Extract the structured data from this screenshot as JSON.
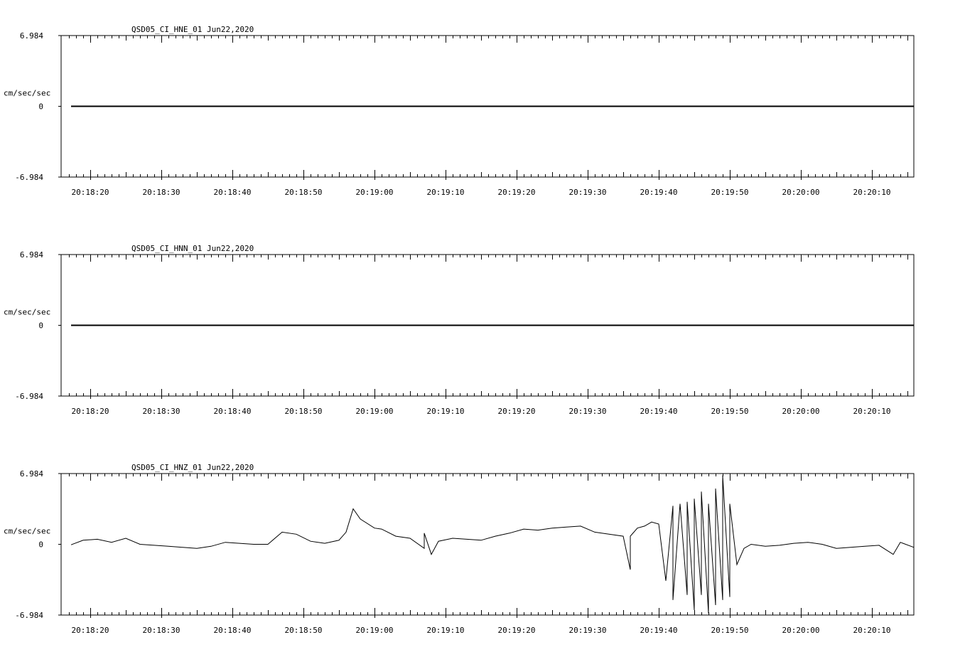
{
  "chart_data": [
    {
      "type": "line",
      "title": "QSD05_CI_HNE_01  Jun22,2020",
      "ylabel": "cm/sec/sec",
      "ylim": [
        -6.984,
        6.984
      ],
      "y_tick_labels": [
        "6.984",
        "0",
        "-6.984"
      ],
      "x_tick_labels": [
        "20:18:20",
        "20:18:30",
        "20:18:40",
        "20:18:50",
        "20:19:00",
        "20:19:10",
        "20:19:20",
        "20:19:30",
        "20:19:40",
        "20:19:50",
        "20:20:00",
        "20:20:10"
      ],
      "series": [
        {
          "x": [
            "20:18:17",
            "20:20:16"
          ],
          "values": [
            0,
            0
          ]
        }
      ]
    },
    {
      "type": "line",
      "title": "QSD05_CI_HNN_01  Jun22,2020",
      "ylabel": "cm/sec/sec",
      "ylim": [
        -6.984,
        6.984
      ],
      "y_tick_labels": [
        "6.984",
        "0",
        "-6.984"
      ],
      "x_tick_labels": [
        "20:18:20",
        "20:18:30",
        "20:18:40",
        "20:18:50",
        "20:19:00",
        "20:19:10",
        "20:19:20",
        "20:19:30",
        "20:19:40",
        "20:19:50",
        "20:20:00",
        "20:20:10"
      ],
      "series": [
        {
          "x": [
            "20:18:17",
            "20:20:16"
          ],
          "values": [
            0,
            0
          ]
        }
      ]
    },
    {
      "type": "line",
      "title": "QSD05_CI_HNZ_01  Jun22,2020",
      "ylabel": "cm/sec/sec",
      "ylim": [
        -6.984,
        6.984
      ],
      "y_tick_labels": [
        "6.984",
        "0",
        "-6.984"
      ],
      "x_tick_labels": [
        "20:18:20",
        "20:18:30",
        "20:18:40",
        "20:18:50",
        "20:19:00",
        "20:19:10",
        "20:19:20",
        "20:19:30",
        "20:19:40",
        "20:19:50",
        "20:20:00",
        "20:20:10"
      ],
      "series": [
        {
          "x": [
            "20:18:17",
            "20:18:19",
            "20:18:21",
            "20:18:23",
            "20:18:25",
            "20:18:27",
            "20:18:29",
            "20:18:31",
            "20:18:33",
            "20:18:35",
            "20:18:37",
            "20:18:39",
            "20:18:41",
            "20:18:43",
            "20:18:45",
            "20:18:47",
            "20:18:49",
            "20:18:51",
            "20:18:53",
            "20:18:55",
            "20:18:56",
            "20:18:57",
            "20:18:58",
            "20:19:00",
            "20:19:01",
            "20:19:03",
            "20:19:05",
            "20:19:07",
            "20:19:07",
            "20:19:08",
            "20:19:09",
            "20:19:11",
            "20:19:13",
            "20:19:15",
            "20:19:17",
            "20:19:19",
            "20:19:21",
            "20:19:23",
            "20:19:25",
            "20:19:27",
            "20:19:29",
            "20:19:31",
            "20:19:33",
            "20:19:35",
            "20:19:36",
            "20:19:36",
            "20:19:37",
            "20:19:38",
            "20:19:39",
            "20:19:40",
            "20:19:41",
            "20:19:42",
            "20:19:42",
            "20:19:43",
            "20:19:44",
            "20:19:44",
            "20:19:45",
            "20:19:45",
            "20:19:46",
            "20:19:46",
            "20:19:47",
            "20:19:47",
            "20:19:48",
            "20:19:48",
            "20:19:49",
            "20:19:49",
            "20:19:50",
            "20:19:50",
            "20:19:51",
            "20:19:52",
            "20:19:53",
            "20:19:55",
            "20:19:57",
            "20:19:59",
            "20:20:01",
            "20:20:03",
            "20:20:05",
            "20:20:07",
            "20:20:09",
            "20:20:11",
            "20:20:13",
            "20:20:14",
            "20:20:16"
          ],
          "values": [
            -0.05,
            0.4,
            0.5,
            0.2,
            0.6,
            0.0,
            -0.1,
            -0.2,
            -0.3,
            -0.4,
            -0.2,
            0.2,
            0.1,
            0.0,
            0.0,
            1.2,
            1.0,
            0.3,
            0.1,
            0.4,
            1.2,
            3.5,
            2.5,
            1.6,
            1.5,
            0.8,
            0.6,
            -0.4,
            1.1,
            -1.0,
            0.3,
            0.6,
            0.5,
            0.4,
            0.8,
            1.1,
            1.5,
            1.4,
            1.6,
            1.7,
            1.8,
            1.2,
            1.0,
            0.8,
            -2.5,
            0.8,
            1.6,
            1.8,
            2.2,
            2.0,
            -3.6,
            3.8,
            -5.5,
            4.0,
            -5.0,
            4.2,
            -6.5,
            4.5,
            -5.0,
            5.2,
            -6.8,
            4.0,
            -6.0,
            5.5,
            -5.5,
            6.8,
            -5.2,
            4.0,
            -2.0,
            -0.4,
            0.0,
            -0.2,
            -0.1,
            0.1,
            0.2,
            0.0,
            -0.4,
            -0.3,
            -0.2,
            -0.1,
            -1.0,
            0.2,
            -0.3
          ]
        }
      ]
    }
  ]
}
